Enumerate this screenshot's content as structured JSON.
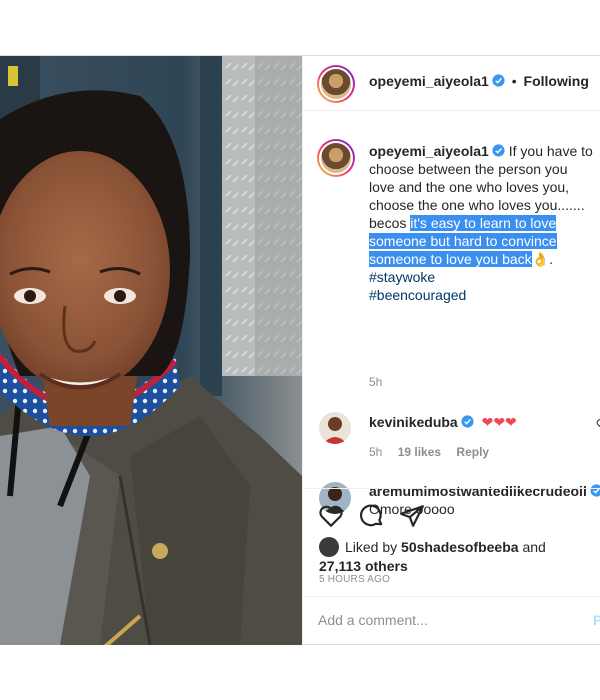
{
  "post": {
    "author": "opeyemi_aiyeola1",
    "follow_status": "Following",
    "separator": "•",
    "caption": {
      "plain": "If you have to choose between the person you love and the one who loves you, choose the one who loves you....... becos",
      "highlighted": "it's easy to learn to love someone but hard to convince someone to love you back",
      "emoji": "👌",
      "after": ".",
      "hashtags": [
        "#staywoke",
        "#beencouraged"
      ],
      "time": "5h"
    },
    "comments": [
      {
        "user": "kevinikeduba",
        "text": "❤❤❤",
        "time": "5h",
        "likes": "19 likes",
        "reply": "Reply"
      },
      {
        "user": "aremumimostwantedlikecrudeoil",
        "text": "Omore ooooo"
      }
    ],
    "likes": {
      "prefix": "Liked by",
      "user": "50shadesofbeeba",
      "conj": "and",
      "others": "27,113 others"
    },
    "time_ago": "5 HOURS AGO",
    "add_comment": {
      "placeholder": "Add a comment...",
      "post_label": "P"
    }
  },
  "colors": {
    "highlight": "#3b8ff0",
    "hashtag": "#00376b",
    "verified": "#3897f0",
    "heart": "#ed4956"
  },
  "icons": [
    "heart-icon",
    "comment-icon",
    "share-icon",
    "verified-icon"
  ]
}
